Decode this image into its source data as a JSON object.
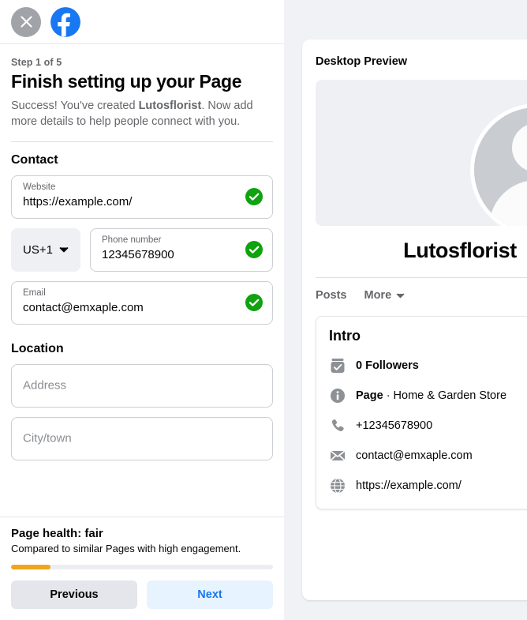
{
  "left": {
    "header": {
      "close_icon": "close-icon",
      "brand_icon": "facebook-logo"
    },
    "step_label": "Step 1 of 5",
    "title": "Finish setting up your Page",
    "subtitle_pre": "Success! You've created ",
    "subtitle_bold": "Lutosflorist",
    "subtitle_post": ". Now add more details to help people connect with you.",
    "contact": {
      "section_title": "Contact",
      "website": {
        "label": "Website",
        "value": "https://example.com/",
        "valid_icon": "check-circle-icon"
      },
      "country": {
        "value": "US+1",
        "chevron_icon": "chevron-down-icon"
      },
      "phone": {
        "label": "Phone number",
        "value": "12345678900",
        "valid_icon": "check-circle-icon"
      },
      "email": {
        "label": "Email",
        "value": "contact@emxaple.com",
        "valid_icon": "check-circle-icon"
      }
    },
    "location": {
      "section_title": "Location",
      "address": {
        "placeholder": "Address",
        "value": ""
      },
      "city": {
        "placeholder": "City/town",
        "value": ""
      }
    },
    "footer": {
      "health_title": "Page health: fair",
      "health_subtitle": "Compared to similar Pages with high engagement.",
      "progress_percent": 15,
      "previous_label": "Previous",
      "next_label": "Next"
    }
  },
  "preview": {
    "title": "Desktop Preview",
    "avatar_icon": "default-avatar-icon",
    "page_name": "Lutosflorist",
    "tabs": [
      {
        "label": "Posts"
      },
      {
        "label": "More",
        "chevron_icon": "chevron-down-icon"
      }
    ],
    "intro": {
      "title": "Intro",
      "rows": [
        {
          "icon": "followers-badge-icon",
          "bold": "0 Followers",
          "rest": ""
        },
        {
          "icon": "info-circle-icon",
          "bold": "Page",
          "rest": " · Home & Garden Store"
        },
        {
          "icon": "phone-icon",
          "bold": "",
          "rest": "+12345678900"
        },
        {
          "icon": "envelope-icon",
          "bold": "",
          "rest": "contact@emxaple.com"
        },
        {
          "icon": "globe-icon",
          "bold": "",
          "rest": "https://example.com/"
        }
      ]
    }
  },
  "colors": {
    "brand_blue": "#1877f2",
    "valid_green": "#0fa30f",
    "progress_orange": "#f0a51e",
    "bg_gray": "#f0f2f5"
  }
}
